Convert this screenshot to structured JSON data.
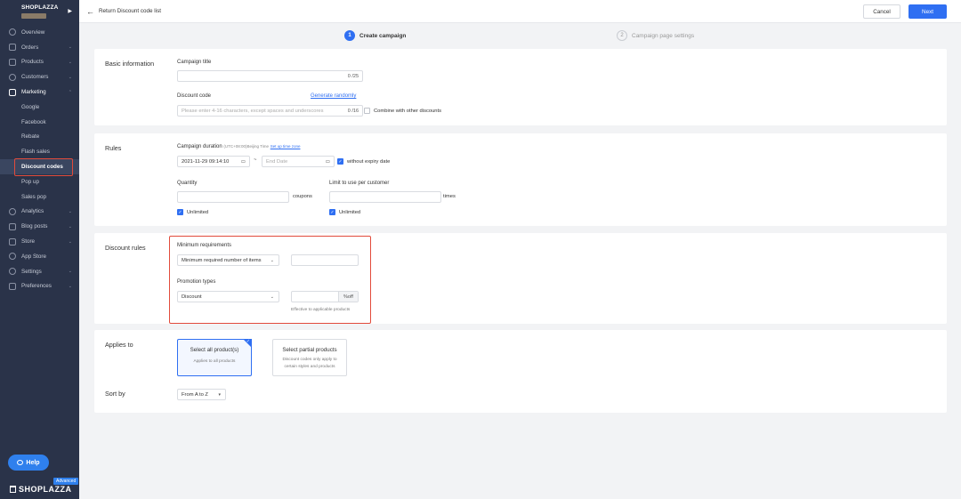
{
  "sidebar": {
    "store_name": "SHOPLAZZA",
    "items": [
      {
        "label": "Overview",
        "icon": "overview-icon",
        "chevron": false
      },
      {
        "label": "Orders",
        "icon": "orders-icon",
        "chevron": true
      },
      {
        "label": "Products",
        "icon": "products-icon",
        "chevron": true
      },
      {
        "label": "Customers",
        "icon": "customers-icon",
        "chevron": true
      },
      {
        "label": "Marketing",
        "icon": "marketing-icon",
        "chevron": true
      }
    ],
    "marketing_sub": [
      "Google",
      "Facebook",
      "Rebate",
      "Flash sales",
      "Discount codes",
      "Pop up",
      "Sales pop"
    ],
    "items_bottom": [
      {
        "label": "Analytics",
        "icon": "analytics-icon",
        "chevron": true
      },
      {
        "label": "Blog posts",
        "icon": "blog-icon",
        "chevron": true
      },
      {
        "label": "Store",
        "icon": "store-icon",
        "chevron": true
      },
      {
        "label": "App Store",
        "icon": "app-store-icon",
        "chevron": false
      },
      {
        "label": "Settings",
        "icon": "settings-icon",
        "chevron": true
      },
      {
        "label": "Preferences",
        "icon": "preferences-icon",
        "chevron": true
      }
    ],
    "help_label": "Help",
    "plan_badge": "Advanced",
    "logo_text": "SHOPLAZZA"
  },
  "topbar": {
    "back_label": "Return Discount code list",
    "cancel_label": "Cancel",
    "next_label": "Next"
  },
  "steps": [
    {
      "num": "1",
      "label": "Create campaign"
    },
    {
      "num": "2",
      "label": "Campaign page settings"
    }
  ],
  "basic": {
    "title": "Basic information",
    "campaign_title_label": "Campaign title",
    "campaign_title_counter": "0 /25",
    "discount_code_label": "Discount code",
    "generate_label": "Generate randomly",
    "code_placeholder": "Please enter 4-16 characters, except spaces and underscores",
    "code_counter": "0 /16",
    "combine_label": "Combine with other discounts"
  },
  "rules": {
    "title": "Rules",
    "duration_label": "Campaign duration",
    "timezone_note": "(UTC+08:00)Beijing Time",
    "timezone_link": "Set up time zone",
    "start_date": "2021-11-29 09:14:10",
    "separator": "~",
    "end_placeholder": "End Date",
    "no_expiry_label": "without expiry date",
    "quantity_label": "Quantity",
    "quantity_suffix": "coupons",
    "quantity_unlimited": "Unlimited",
    "limit_label": "Limit to use per customer",
    "limit_suffix": "times",
    "limit_unlimited": "Unlimited"
  },
  "discount_rules": {
    "title": "Discount rules",
    "min_req_label": "Minimum requirements",
    "min_req_value": "Minimum required number of items",
    "promo_label": "Promotion types",
    "promo_value": "Discount",
    "percent_addon": "%off",
    "effective_note": "Effective to applicable products"
  },
  "applies": {
    "title": "Applies to",
    "opt_all_title": "Select all product(s)",
    "opt_all_desc": "Applies to all products",
    "opt_partial_title": "Select partial products",
    "opt_partial_desc": "Discount codes only apply to certain styles and products",
    "sort_label": "Sort by",
    "sort_value": "From A to Z"
  },
  "colors": {
    "accent": "#2f6ff2",
    "sidebar": "#2a3349",
    "highlight": "#e24b3b"
  }
}
